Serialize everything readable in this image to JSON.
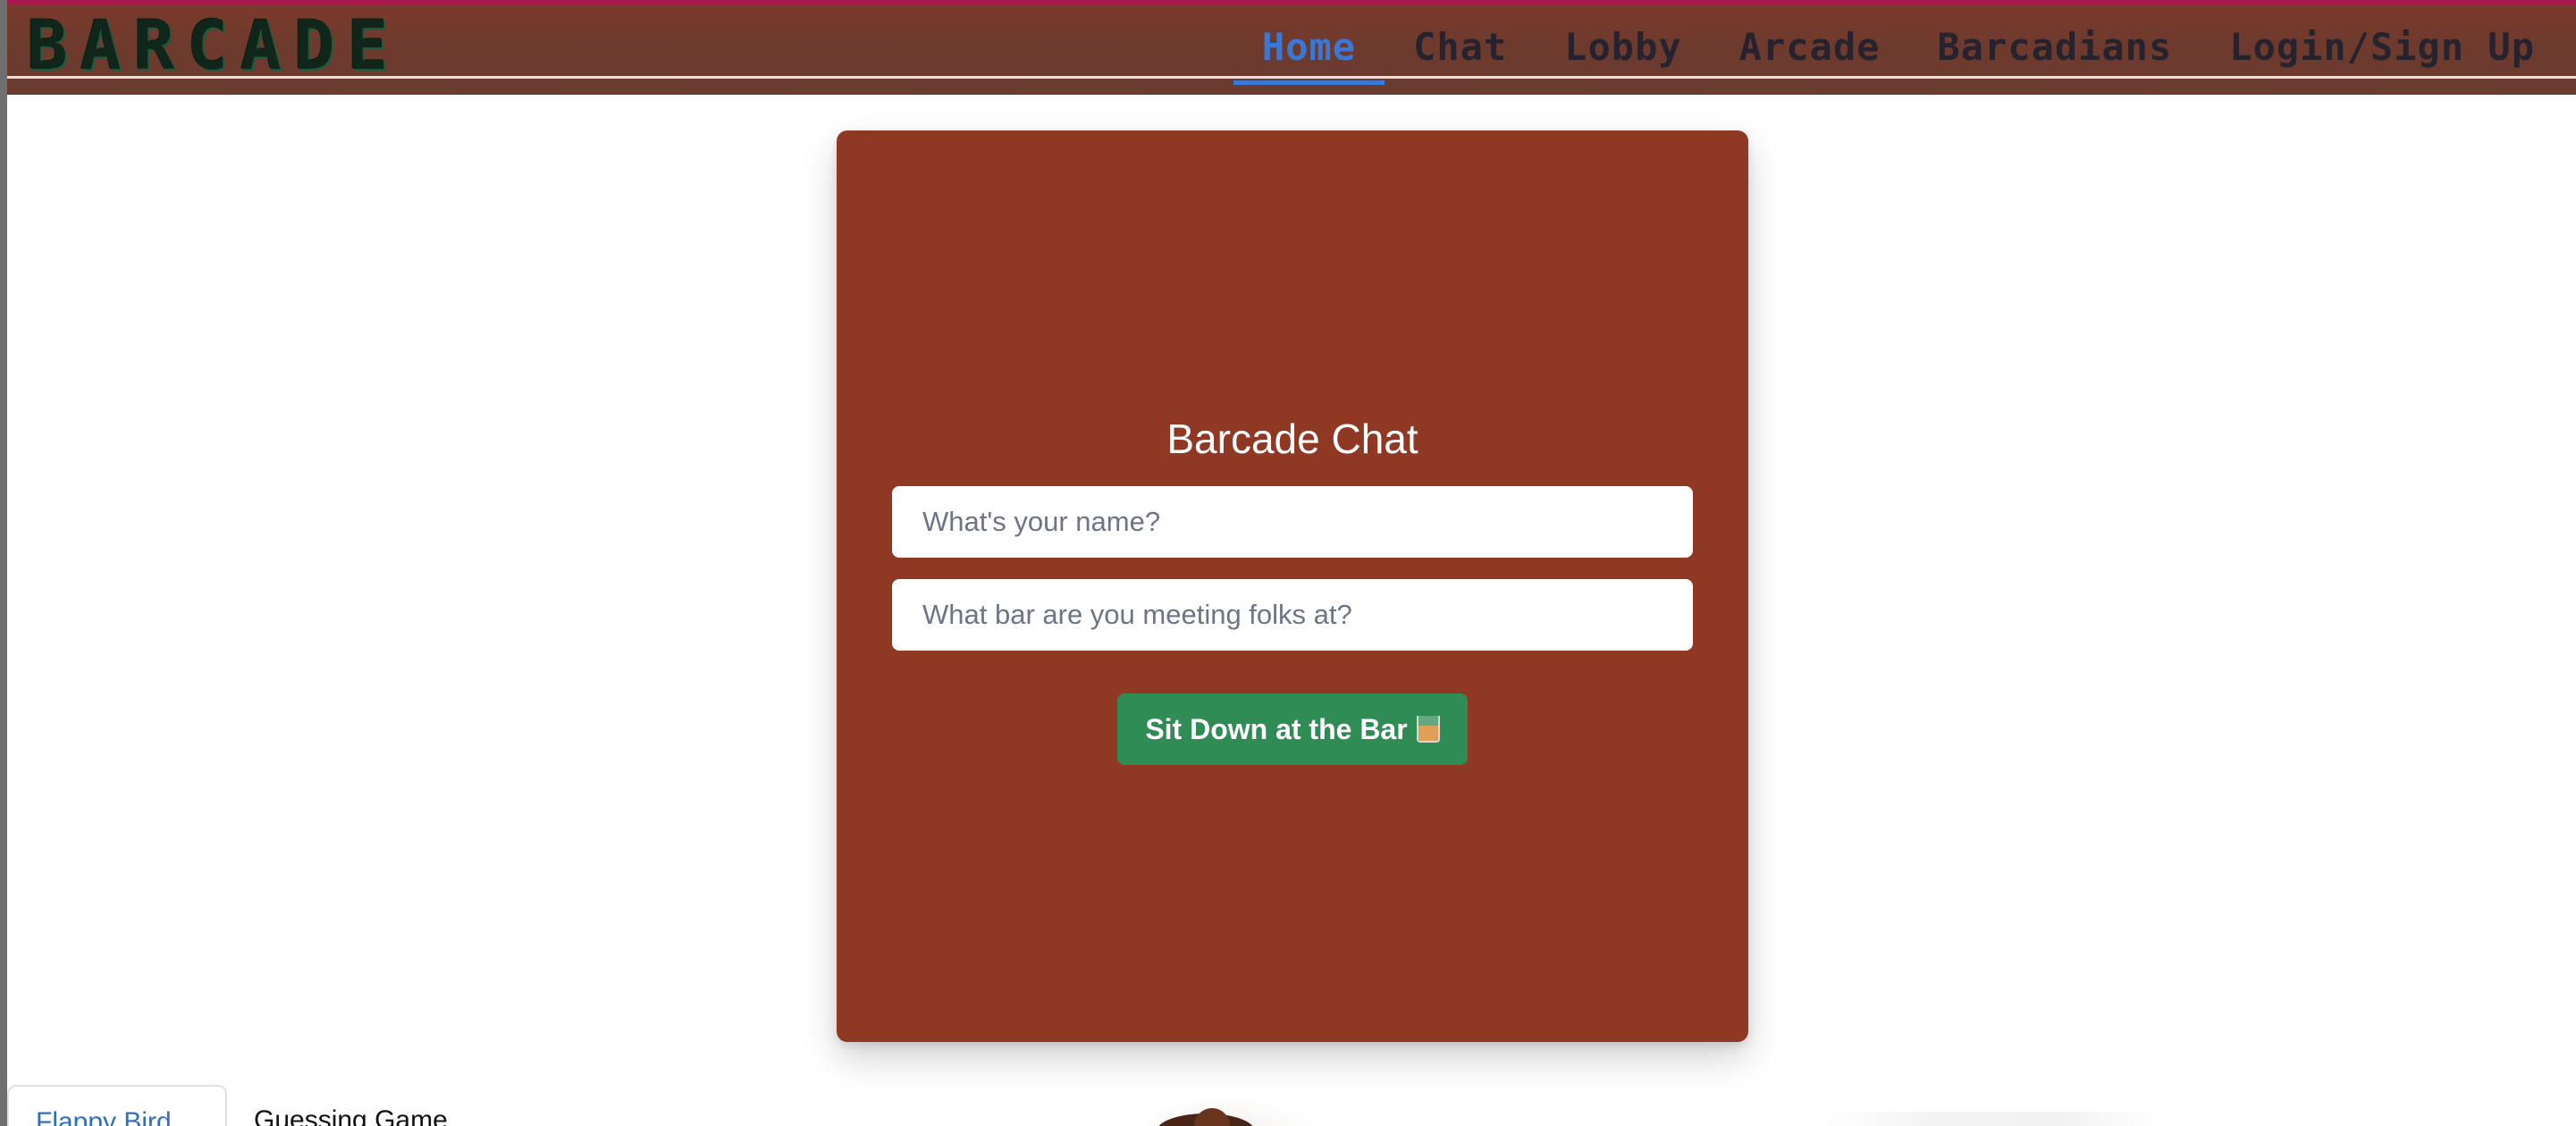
{
  "navbar": {
    "logo_text": "BARCADE",
    "links": [
      {
        "label": "Home",
        "active": true
      },
      {
        "label": "Chat",
        "active": false
      },
      {
        "label": "Lobby",
        "active": false
      },
      {
        "label": "Arcade",
        "active": false
      },
      {
        "label": "Barcadians",
        "active": false
      },
      {
        "label": "Login/Sign Up",
        "active": false
      }
    ],
    "accent_color": "#3a78d8",
    "background_color": "#6e3a2e"
  },
  "chat_card": {
    "title": "Barcade Chat",
    "name_placeholder": "What's your name?",
    "bar_placeholder": "What bar are you meeting folks at?",
    "submit_label": "Sit Down at the Bar",
    "submit_icon": "whisky-glass-icon",
    "card_color": "#8f3824",
    "button_color": "#2f8c55"
  },
  "bottom_tabs": [
    {
      "label": "Flappy Bird",
      "active": true
    },
    {
      "label": "Guessing Game",
      "active": false
    }
  ]
}
